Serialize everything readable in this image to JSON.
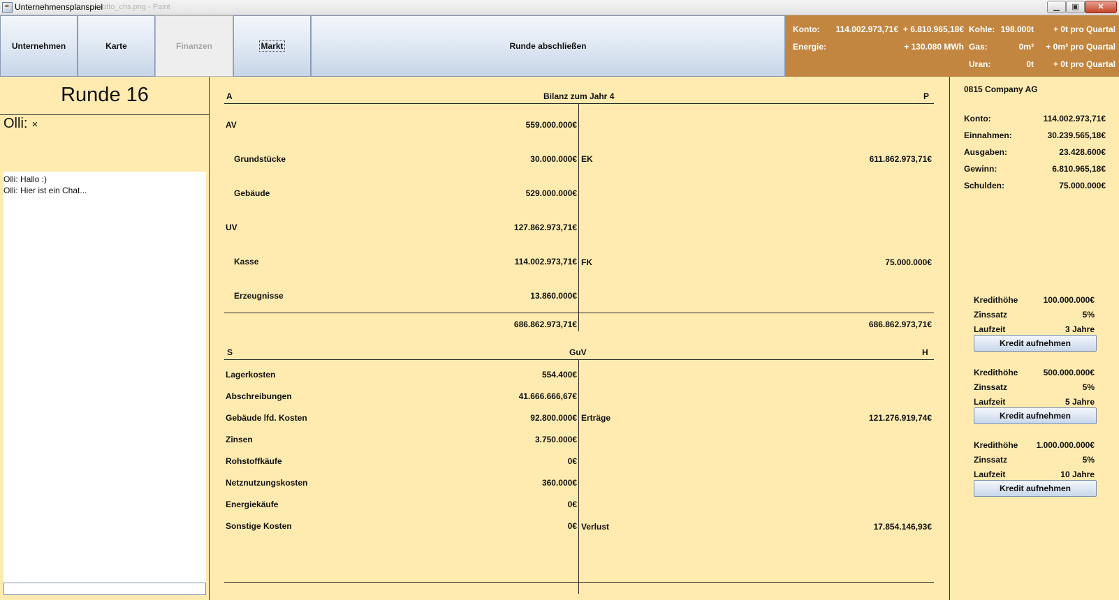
{
  "window": {
    "title": "Unternehmensplanspiel",
    "ghost_title": "otto_chs.png - Paint",
    "minimize": "▁",
    "maximize": "▣",
    "close": "✕"
  },
  "nav": {
    "unternehmen": "Unternehmen",
    "karte": "Karte",
    "finanzen": "Finanzen",
    "markt": "Markt",
    "runde": "Runde abschließen"
  },
  "stats": {
    "konto_label": "Konto:",
    "konto_value": "114.002.973,71€",
    "konto_delta": "+ 6.810.965,18€",
    "energie_label": "Energie:",
    "energie_delta": "+ 130.080 MWh",
    "kohle_label": "Kohle:",
    "kohle_value": "198.000t",
    "kohle_delta": "+ 0t pro Quartal",
    "gas_label": "Gas:",
    "gas_value": "0m³",
    "gas_delta": "+ 0m³ pro Quartal",
    "uran_label": "Uran:",
    "uran_value": "0t",
    "uran_delta": "+ 0t pro Quartal"
  },
  "left": {
    "round": "Runde 16",
    "player": "Olli:",
    "close_icon": "×",
    "chat": [
      "Olli: Hallo :)",
      "Olli: Hier ist ein Chat..."
    ],
    "input_value": ""
  },
  "bilanz": {
    "a": "A",
    "title": "Bilanz zum Jahr 4",
    "p": "P",
    "av": "AV",
    "av_value": "559.000.000€",
    "grundstuecke": "Grundstücke",
    "grundstuecke_value": "30.000.000€",
    "gebaeude": "Gebäude",
    "gebaeude_value": "529.000.000€",
    "uv": "UV",
    "uv_value": "127.862.973,71€",
    "kasse": "Kasse",
    "kasse_value": "114.002.973,71€",
    "erzeugnisse": "Erzeugnisse",
    "erzeugnisse_value": "13.860.000€",
    "ek": "EK",
    "ek_value": "611.862.973,71€",
    "fk": "FK",
    "fk_value": "75.000.000€",
    "total_left": "686.862.973,71€",
    "total_right": "686.862.973,71€"
  },
  "guv": {
    "s": "S",
    "title": "GuV",
    "h": "H",
    "lagerkosten": "Lagerkosten",
    "lagerkosten_value": "554.400€",
    "abschreibungen": "Abschreibungen",
    "abschreibungen_value": "41.666.666,67€",
    "gebaeude_kosten": "Gebäude lfd. Kosten",
    "gebaeude_kosten_value": "92.800.000€",
    "zinsen": "Zinsen",
    "zinsen_value": "3.750.000€",
    "rohstoffkaeufe": "Rohstoffkäufe",
    "rohstoffkaeufe_value": "0€",
    "netznutzung": "Netznutzungskosten",
    "netznutzung_value": "360.000€",
    "energiekaeufe": "Energiekäufe",
    "energiekaeufe_value": "0€",
    "sonstige": "Sonstige Kosten",
    "sonstige_value": "0€",
    "ertraege": "Erträge",
    "ertraege_value": "121.276.919,74€",
    "verlust": "Verlust",
    "verlust_value": "17.854.146,93€"
  },
  "company": {
    "name": "0815 Company AG",
    "konto_label": "Konto:",
    "konto_value": "114.002.973,71€",
    "einnahmen_label": "Einnahmen:",
    "einnahmen_value": "30.239.565,18€",
    "ausgaben_label": "Ausgaben:",
    "ausgaben_value": "23.428.600€",
    "gewinn_label": "Gewinn:",
    "gewinn_value": "6.810.965,18€",
    "schulden_label": "Schulden:",
    "schulden_value": "75.000.000€"
  },
  "credits": [
    {
      "hoehe_label": "Kredithöhe",
      "hoehe": "100.000.000€",
      "zins_label": "Zinssatz",
      "zins": "5%",
      "laufzeit_label": "Laufzeit",
      "laufzeit": "3 Jahre",
      "button": "Kredit aufnehmen"
    },
    {
      "hoehe_label": "Kredithöhe",
      "hoehe": "500.000.000€",
      "zins_label": "Zinssatz",
      "zins": "5%",
      "laufzeit_label": "Laufzeit",
      "laufzeit": "5 Jahre",
      "button": "Kredit aufnehmen"
    },
    {
      "hoehe_label": "Kredithöhe",
      "hoehe": "1.000.000.000€",
      "zins_label": "Zinssatz",
      "zins": "5%",
      "laufzeit_label": "Laufzeit",
      "laufzeit": "10 Jahre",
      "button": "Kredit aufnehmen"
    }
  ]
}
